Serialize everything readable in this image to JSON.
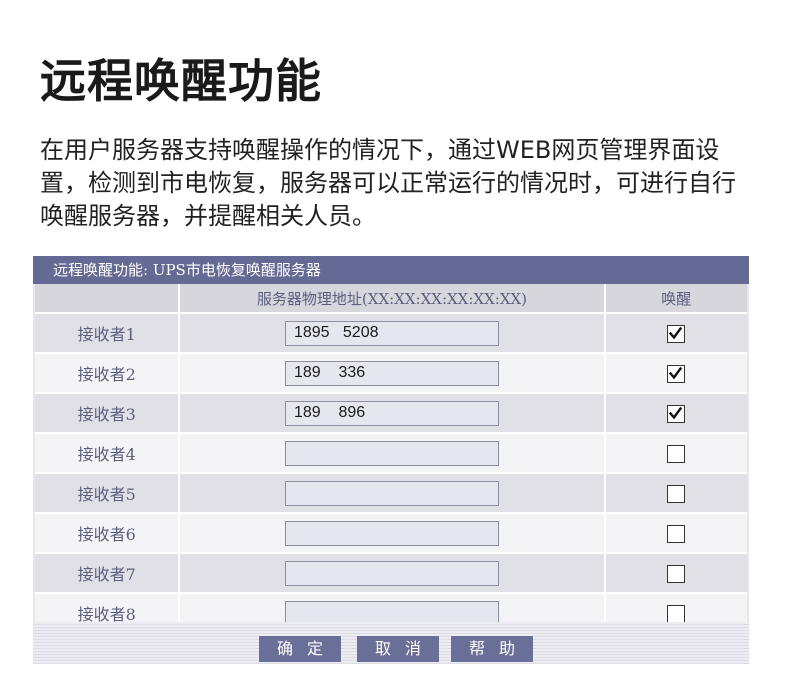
{
  "heading": "远程唤醒功能",
  "description": "在用户服务器支持唤醒操作的情况下，通过WEB网页管理界面设置，检测到市电恢复，服务器可以正常运行的情况时，可进行自行唤醒服务器，并提醒相关人员。",
  "panel": {
    "title": "远程唤醒功能:  UPS市电恢复唤醒服务器",
    "headers": {
      "label": "",
      "mac": "服务器物理地址(XX:XX:XX:XX:XX:XX)",
      "wake": "唤醒"
    },
    "rows": [
      {
        "label": "接收者1",
        "mac": "1895   5208",
        "checked": true
      },
      {
        "label": "接收者2",
        "mac": "189    336",
        "checked": true
      },
      {
        "label": "接收者3",
        "mac": "189    896",
        "checked": true
      },
      {
        "label": "接收者4",
        "mac": "",
        "checked": false
      },
      {
        "label": "接收者5",
        "mac": "",
        "checked": false
      },
      {
        "label": "接收者6",
        "mac": "",
        "checked": false
      },
      {
        "label": "接收者7",
        "mac": "",
        "checked": false
      },
      {
        "label": "接收者8",
        "mac": "",
        "checked": false
      }
    ]
  },
  "buttons": {
    "confirm": "确定",
    "cancel": "取消",
    "help": "帮助"
  },
  "colors": {
    "title_bar": "#646a93",
    "button": "#6a6f97",
    "label_text": "#5c607e"
  },
  "icons": {
    "checked": "checkmark-icon"
  }
}
